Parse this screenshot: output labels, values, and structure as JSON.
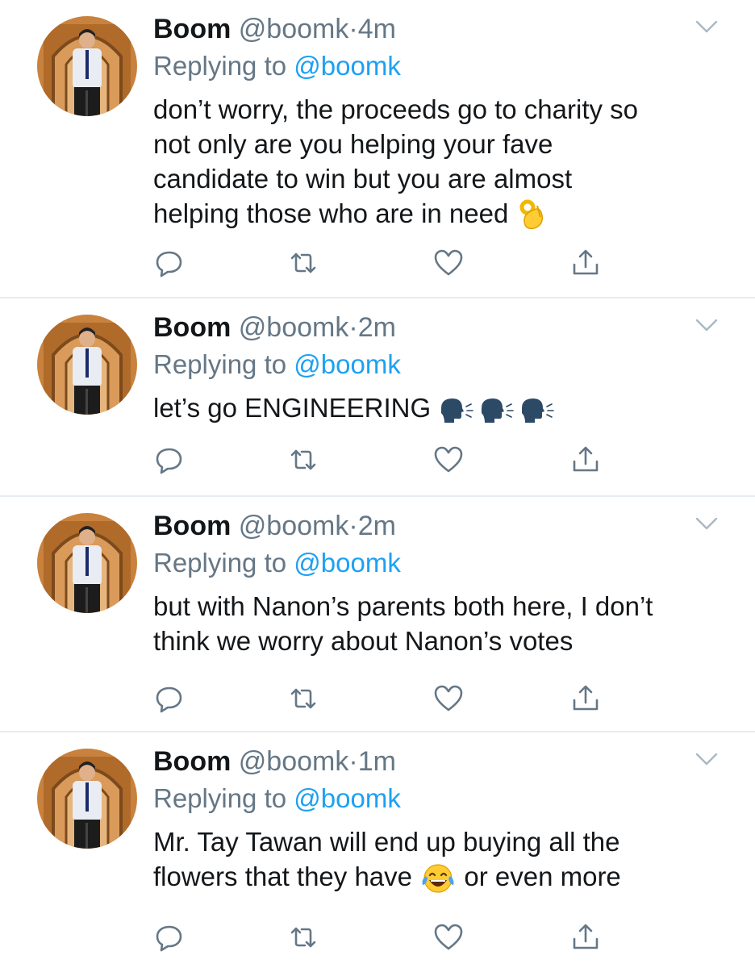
{
  "tweets": [
    {
      "name": "Boom",
      "handle": "@boomk",
      "dot": "·",
      "time": "4m",
      "replying_prefix": "Replying to",
      "replying_to": "@boomk",
      "text": [
        "don’t worry, the proceeds go to charity so",
        "not only are you helping your fave",
        "candidate to win but you are almost",
        "helping those who are in need"
      ],
      "emoji": "ok-hand"
    },
    {
      "name": "Boom",
      "handle": "@boomk",
      "dot": "·",
      "time": "2m",
      "replying_prefix": "Replying to",
      "replying_to": "@boomk",
      "text": [
        "let’s go ENGINEERING"
      ],
      "emoji": "speaking-head x3"
    },
    {
      "name": "Boom",
      "handle": "@boomk",
      "dot": "·",
      "time": "2m",
      "replying_prefix": "Replying to",
      "replying_to": "@boomk",
      "text": [
        "but with Nanon’s parents both here, I don’t",
        "think we worry about Nanon’s votes"
      ]
    },
    {
      "name": "Boom",
      "handle": "@boomk",
      "dot": "·",
      "time": "1m",
      "replying_prefix": "Replying to",
      "replying_to": "@boomk",
      "text": [
        "Mr. Tay Tawan will end up buying all the",
        "flowers that they have",
        "or even more"
      ],
      "emoji": "tears-of-joy"
    }
  ],
  "icons": {
    "reply": "reply-icon",
    "retweet": "retweet-icon",
    "like": "heart-icon",
    "share": "share-icon",
    "menu": "chevron-down-icon"
  },
  "colors": {
    "accent": "#1da1f2",
    "muted": "#657786",
    "divider": "#e6ecf0",
    "text": "#14171a"
  }
}
